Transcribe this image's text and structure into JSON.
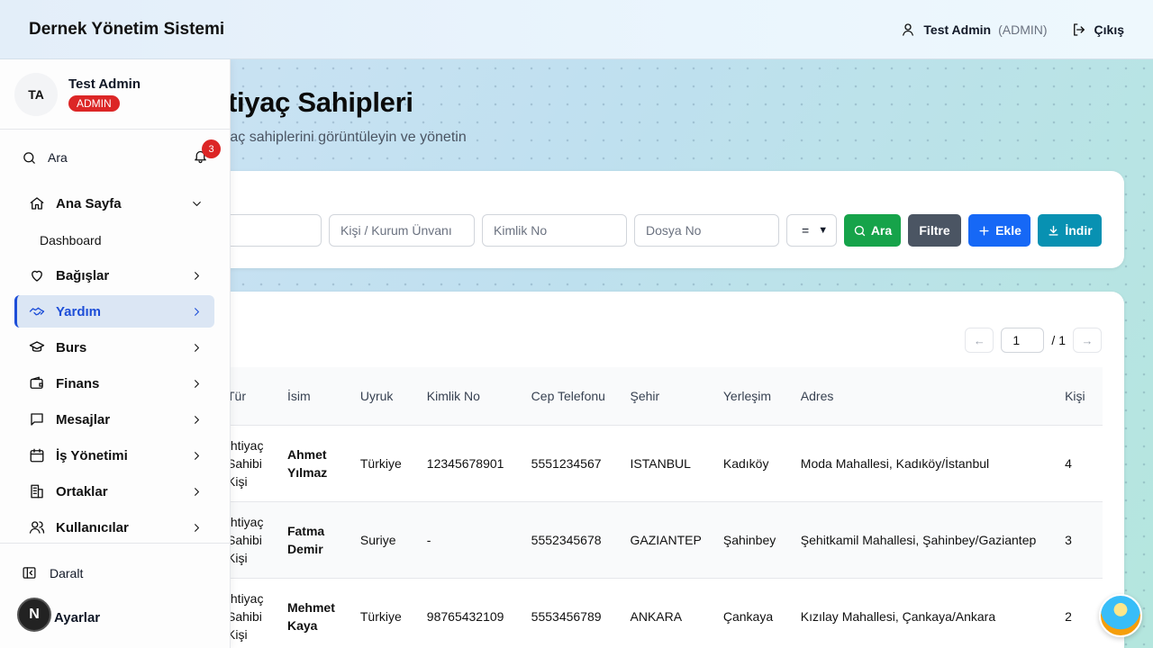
{
  "header": {
    "app_title": "Dernek Yönetim Sistemi",
    "user_name": "Test Admin",
    "user_role": "(ADMIN)",
    "logout_label": "Çıkış"
  },
  "page": {
    "title": "İhtiyaç Sahipleri",
    "subtitle": "İhtiyaç sahiplerini görüntüleyin ve yönetin"
  },
  "filters": {
    "search_placeholder": "",
    "name_placeholder": "Kişi / Kurum Ünvanı",
    "id_placeholder": "Kimlik No",
    "file_placeholder": "Dosya No",
    "operator_value": "=",
    "search_label": "Ara",
    "filter_label": "Filtre",
    "add_label": "Ekle",
    "download_label": "İndir"
  },
  "pagination": {
    "prev": "←",
    "current": "1",
    "total": "/ 1",
    "next": "→"
  },
  "table": {
    "headers": {
      "type": "Tür",
      "name": "İsim",
      "nationality": "Uyruk",
      "id_no": "Kimlik No",
      "phone": "Cep Telefonu",
      "city": "Şehir",
      "district": "Yerleşim",
      "address": "Adres",
      "people": "Kişi"
    },
    "rows": [
      {
        "type": "İhtiyaç Sahibi Kişi",
        "name": "Ahmet Yılmaz",
        "nationality": "Türkiye",
        "id_no": "12345678901",
        "phone": "5551234567",
        "city": "ISTANBUL",
        "district": "Kadıköy",
        "address": "Moda Mahallesi, Kadıköy/İstanbul",
        "people": "4"
      },
      {
        "type": "İhtiyaç Sahibi Kişi",
        "name": "Fatma Demir",
        "nationality": "Suriye",
        "id_no": "-",
        "phone": "5552345678",
        "city": "GAZIANTEP",
        "district": "Şahinbey",
        "address": "Şehitkamil Mahallesi, Şahinbey/Gaziantep",
        "people": "3"
      },
      {
        "type": "İhtiyaç Sahibi Kişi",
        "name": "Mehmet Kaya",
        "nationality": "Türkiye",
        "id_no": "98765432109",
        "phone": "5553456789",
        "city": "ANKARA",
        "district": "Çankaya",
        "address": "Kızılay Mahallesi, Çankaya/Ankara",
        "people": "2"
      }
    ]
  },
  "sidebar": {
    "avatar_initials": "TA",
    "user_name": "Test Admin",
    "user_badge": "ADMIN",
    "search_label": "Ara",
    "notification_count": "3",
    "items": [
      {
        "label": "Ana Sayfa"
      },
      {
        "label": "Bağışlar"
      },
      {
        "label": "Yardım"
      },
      {
        "label": "Burs"
      },
      {
        "label": "Finans"
      },
      {
        "label": "Mesajlar"
      },
      {
        "label": "İş Yönetimi"
      },
      {
        "label": "Ortaklar"
      },
      {
        "label": "Kullanıcılar"
      }
    ],
    "sub_dashboard": "Dashboard",
    "collapse_label": "Daralt",
    "settings_label": "Ayarlar"
  },
  "floating": {
    "dev_badge": "N"
  },
  "colors": {
    "accent": "#1d4ed8",
    "badge_red": "#dc2626",
    "btn_green": "#16a34a",
    "btn_gray": "#4b5563",
    "btn_blue": "#1668f6",
    "btn_teal": "#0891b2"
  }
}
